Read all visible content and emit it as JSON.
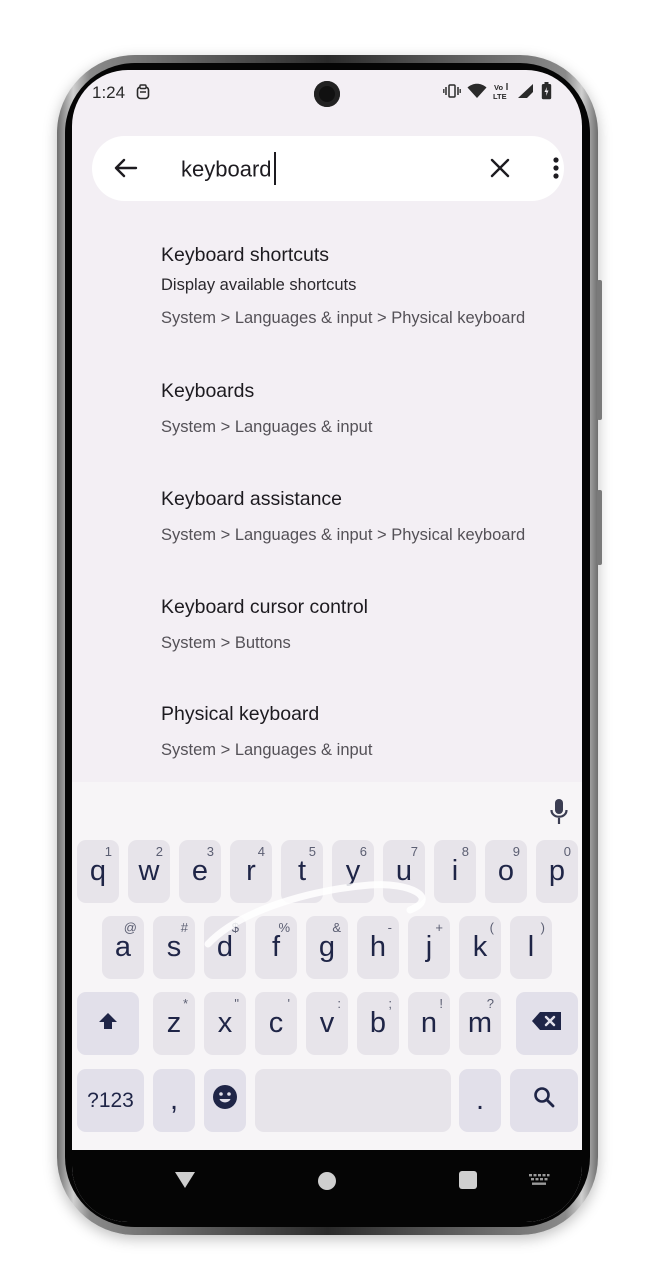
{
  "status_bar": {
    "time": "1:24",
    "notification_icon": "clipboard-icon",
    "icons": [
      "vibrate-icon",
      "wifi-icon",
      "volte-icon",
      "signal-icon",
      "battery-icon"
    ],
    "volte_label": "Vo LTE"
  },
  "search": {
    "back_icon": "arrow-back-icon",
    "query": "keyboard",
    "clear_icon": "close-icon",
    "more_icon": "more-vert-icon"
  },
  "results": [
    {
      "title": "Keyboard shortcuts",
      "summary": "Display available shortcuts",
      "path": "System > Languages & input > Physical keyboard"
    },
    {
      "title": "Keyboards",
      "summary": "",
      "path": "System > Languages & input"
    },
    {
      "title": "Keyboard assistance",
      "summary": "",
      "path": "System > Languages & input > Physical keyboard"
    },
    {
      "title": "Keyboard cursor control",
      "summary": "",
      "path": "System > Buttons"
    },
    {
      "title": "Physical keyboard",
      "summary": "",
      "path": "System > Languages & input"
    }
  ],
  "keyboard": {
    "mic_icon": "microphone-icon",
    "row1": [
      {
        "label": "q",
        "hint": "1"
      },
      {
        "label": "w",
        "hint": "2"
      },
      {
        "label": "e",
        "hint": "3"
      },
      {
        "label": "r",
        "hint": "4"
      },
      {
        "label": "t",
        "hint": "5"
      },
      {
        "label": "y",
        "hint": "6"
      },
      {
        "label": "u",
        "hint": "7"
      },
      {
        "label": "i",
        "hint": "8"
      },
      {
        "label": "o",
        "hint": "9"
      },
      {
        "label": "p",
        "hint": "0"
      }
    ],
    "row2": [
      {
        "label": "a",
        "hint": "@"
      },
      {
        "label": "s",
        "hint": "#"
      },
      {
        "label": "d",
        "hint": "$"
      },
      {
        "label": "f",
        "hint": "%"
      },
      {
        "label": "g",
        "hint": "&"
      },
      {
        "label": "h",
        "hint": "-"
      },
      {
        "label": "j",
        "hint": "+"
      },
      {
        "label": "k",
        "hint": "("
      },
      {
        "label": "l",
        "hint": ")"
      }
    ],
    "row3": [
      {
        "label": "z",
        "hint": "*"
      },
      {
        "label": "x",
        "hint": "\""
      },
      {
        "label": "c",
        "hint": "'"
      },
      {
        "label": "v",
        "hint": ":"
      },
      {
        "label": "b",
        "hint": ";"
      },
      {
        "label": "n",
        "hint": "!"
      },
      {
        "label": "m",
        "hint": "?"
      }
    ],
    "shift_icon": "shift-icon",
    "backspace_icon": "backspace-icon",
    "symbols_label": "?123",
    "comma_label": ",",
    "emoji_icon": "emoji-icon",
    "period_label": ".",
    "search_icon": "search-icon"
  },
  "nav_bar": {
    "back_icon": "nav-back-icon",
    "home_icon": "nav-home-icon",
    "recents_icon": "nav-recents-icon",
    "keyboard_icon": "keyboard-switch-icon"
  }
}
